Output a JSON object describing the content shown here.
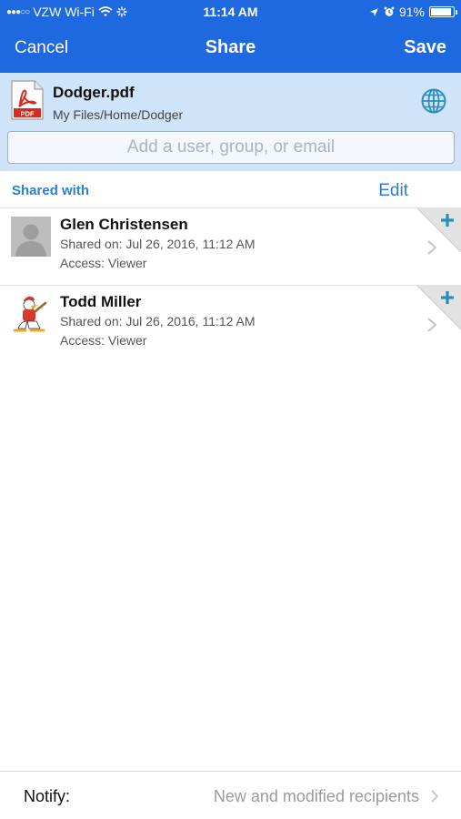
{
  "status_bar": {
    "carrier": "VZW Wi-Fi",
    "time": "11:14 AM",
    "battery": "91%",
    "battery_level": 0.91
  },
  "nav": {
    "cancel_label": "Cancel",
    "title": "Share",
    "save_label": "Save"
  },
  "file": {
    "icon_text": "PDF",
    "name": "Dodger.pdf",
    "path": "My Files/Home/Dodger"
  },
  "search": {
    "placeholder": "Add a user, group, or email"
  },
  "section": {
    "title": "Shared with",
    "edit_label": "Edit"
  },
  "shares": [
    {
      "name": "Glen Christensen",
      "shared_on": "Shared on: Jul 26, 2016, 11:12 AM",
      "access": "Access: Viewer",
      "avatar": "default-user-avatar"
    },
    {
      "name": "Todd Miller",
      "shared_on": "Shared on: Jul 26, 2016, 11:12 AM",
      "access": "Access: Viewer",
      "avatar": "cartoon-avatar"
    }
  ],
  "notify": {
    "label": "Notify:",
    "value": "New and modified recipients"
  },
  "colors": {
    "nav_bg": "#1e68e0",
    "file_header_bg": "#cfe4f9",
    "accent": "#2a7fd4",
    "add_badge": "#2a8fb8"
  }
}
